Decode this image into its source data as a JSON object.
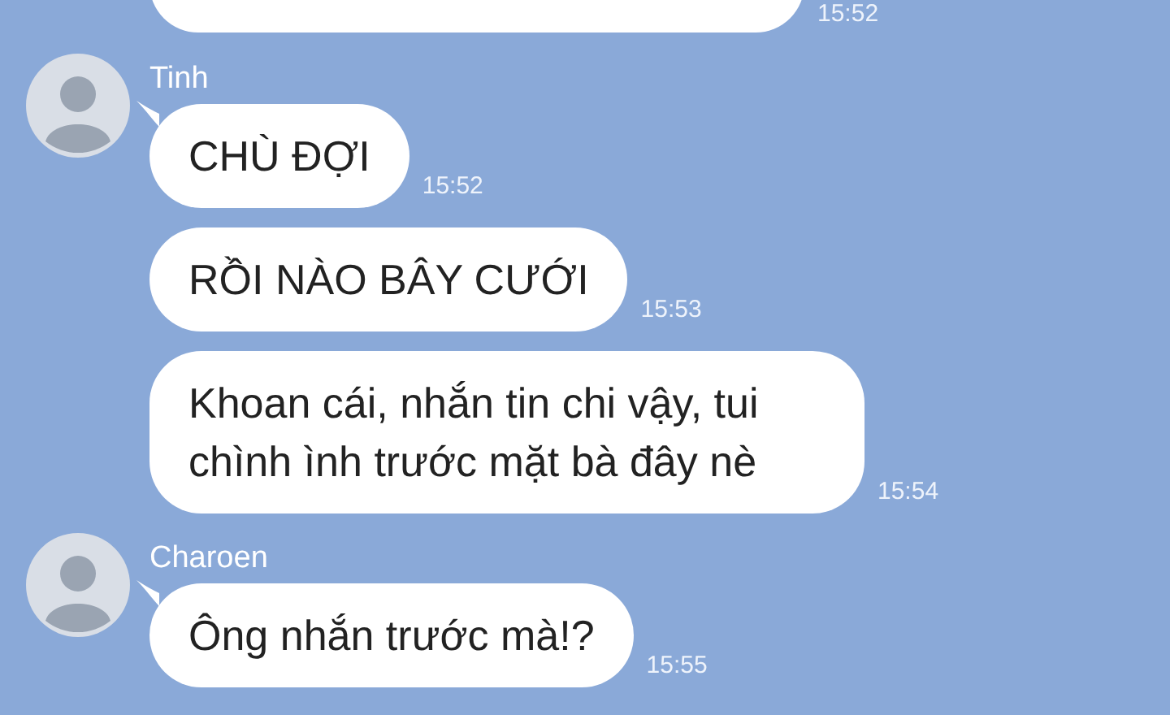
{
  "top_message": {
    "time": "15:52"
  },
  "groups": [
    {
      "sender": "Tinh",
      "messages": [
        {
          "text": "CHÙ ĐỢI",
          "time": "15:52"
        },
        {
          "text": "RỒI NÀO BÂY CƯỚI",
          "time": "15:53"
        },
        {
          "text": "Khoan cái, nhắn tin chi vậy, tui chình ình trước mặt bà đây nè",
          "time": "15:54"
        }
      ]
    },
    {
      "sender": "Charoen",
      "messages": [
        {
          "text": "Ông nhắn trước mà!?",
          "time": "15:55"
        }
      ]
    }
  ]
}
